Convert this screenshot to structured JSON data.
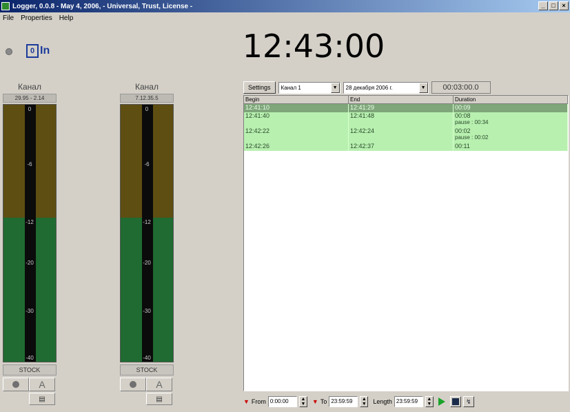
{
  "window": {
    "title": "Logger, 0.0.8 - May 4, 2006, - Universal, Trust, License -",
    "buttons": [
      "_",
      "□",
      "×"
    ]
  },
  "menu": [
    "File",
    "Properties",
    "Help"
  ],
  "logo": {
    "box": "0",
    "text": "In"
  },
  "clock": "12:43:00",
  "channels": [
    {
      "name": "Канал",
      "sub": "29.95 - 2.14",
      "scale": [
        "0",
        "-6",
        "-12",
        "-20",
        "-30",
        "-40"
      ],
      "stop_label": "STOCK",
      "ctl_a": "A"
    },
    {
      "name": "Канал",
      "sub": "7.12.35.5",
      "scale": [
        "0",
        "-6",
        "-12",
        "-20",
        "-30",
        "-40"
      ],
      "stop_label": "STOCK",
      "ctl_a": "A"
    }
  ],
  "toolbar": {
    "settings_label": "Settings",
    "channel_select": "Канал 1",
    "date_select": "28 декабря 2006 г.",
    "duration_total": "00:03:00.0"
  },
  "log": {
    "columns": [
      "Begin",
      "End",
      "Duration"
    ],
    "rows": [
      {
        "begin": "12:41:10",
        "end": "12:41:29",
        "duration": "00:09",
        "pause": "",
        "selected": true
      },
      {
        "begin": "12:41:40",
        "end": "12:41:48",
        "duration": "00:08",
        "pause": "pause : 00:34",
        "selected": false
      },
      {
        "begin": "12:42:22",
        "end": "12:42:24",
        "duration": "00:02",
        "pause": "pause : 00:02",
        "selected": false
      },
      {
        "begin": "12:42:26",
        "end": "12:42:37",
        "duration": "00:11",
        "pause": "",
        "selected": false
      }
    ]
  },
  "bottom": {
    "from_label": "From",
    "from_value": "0:00:00",
    "to_label": "To",
    "to_value": "23:59:59",
    "length_label": "Length",
    "length_value": "23:59:59"
  },
  "colors": {
    "meter_amber": "#5e4e12",
    "meter_green": "#1f6b32",
    "row_green": "#b8f0b0",
    "row_selected": "#7fa67a"
  }
}
